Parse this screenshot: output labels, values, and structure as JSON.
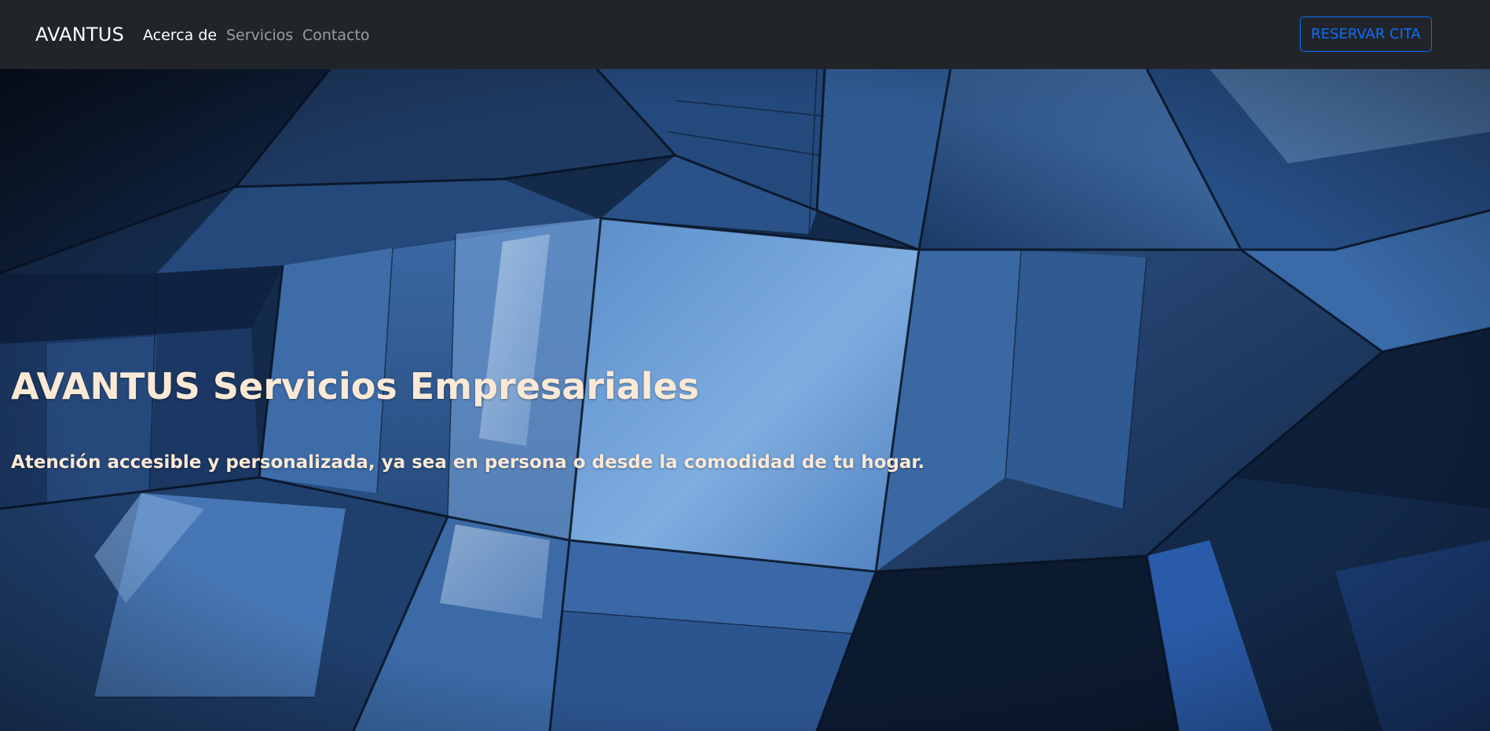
{
  "navbar": {
    "brand": "AVANTUS",
    "links": [
      {
        "label": "Acerca de",
        "active": true
      },
      {
        "label": "Servicios",
        "active": false
      },
      {
        "label": "Contacto",
        "active": false
      }
    ],
    "cta_label": "RESERVAR CITA"
  },
  "hero": {
    "title": "AVANTUS Servicios Empresariales",
    "subtitle": "Atención accesible y personalizada, ya sea en persona o desde la comodidad de tu hogar.",
    "background": "glass-architecture-image"
  },
  "colors": {
    "navbar_bg": "#212529",
    "accent": "#0d6efd",
    "hero_text": "#fbe9d6"
  }
}
